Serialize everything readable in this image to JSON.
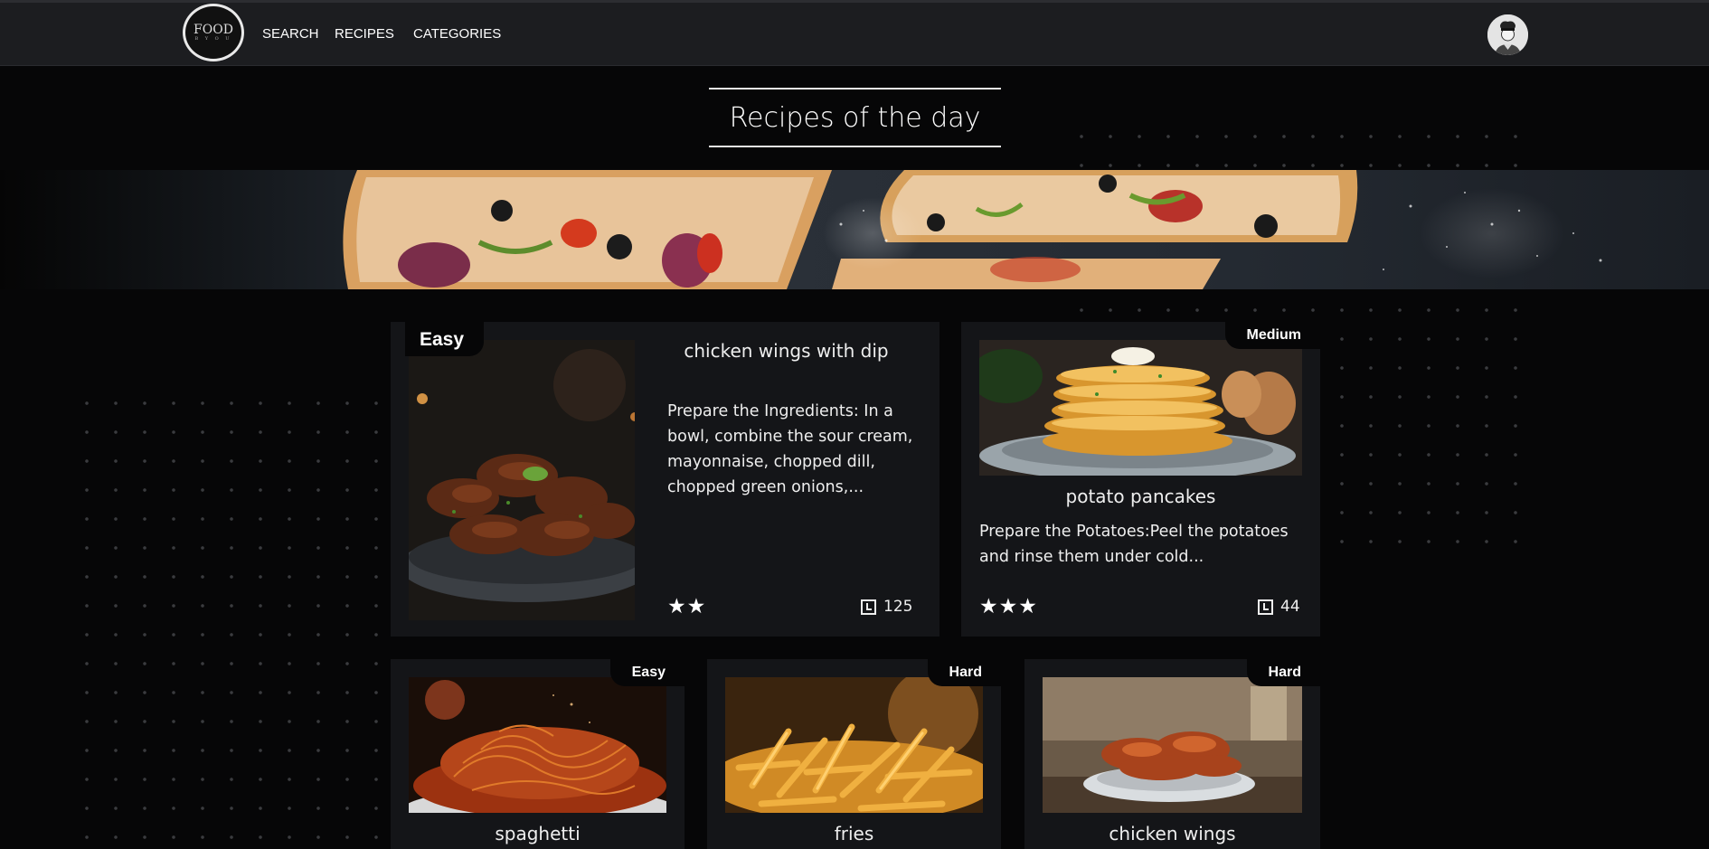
{
  "header": {
    "logo_line1": "FOOD",
    "logo_line2": "B Y O U",
    "nav": [
      "SEARCH",
      "RECIPES",
      "CATEGORIES"
    ]
  },
  "page_title": "Recipes of the day",
  "cards": [
    {
      "difficulty": "Easy",
      "title": "chicken wings with dip",
      "description": "Prepare the Ingredients: In a bowl, combine the sour cream, mayonnaise, chopped dill, chopped green onions,...",
      "stars": "★★",
      "time": "125"
    },
    {
      "difficulty": "Medium",
      "title": "potato pancakes",
      "description": "Prepare the Potatoes:Peel the potatoes and rinse them under cold...",
      "stars": "★★★",
      "time": "44"
    },
    {
      "difficulty": "Easy",
      "title": "spaghetti"
    },
    {
      "difficulty": "Hard",
      "title": "fries"
    },
    {
      "difficulty": "Hard",
      "title": "chicken wings"
    }
  ],
  "colors": {
    "background": "#060607",
    "card": "#141518",
    "header": "#1c1d20"
  }
}
